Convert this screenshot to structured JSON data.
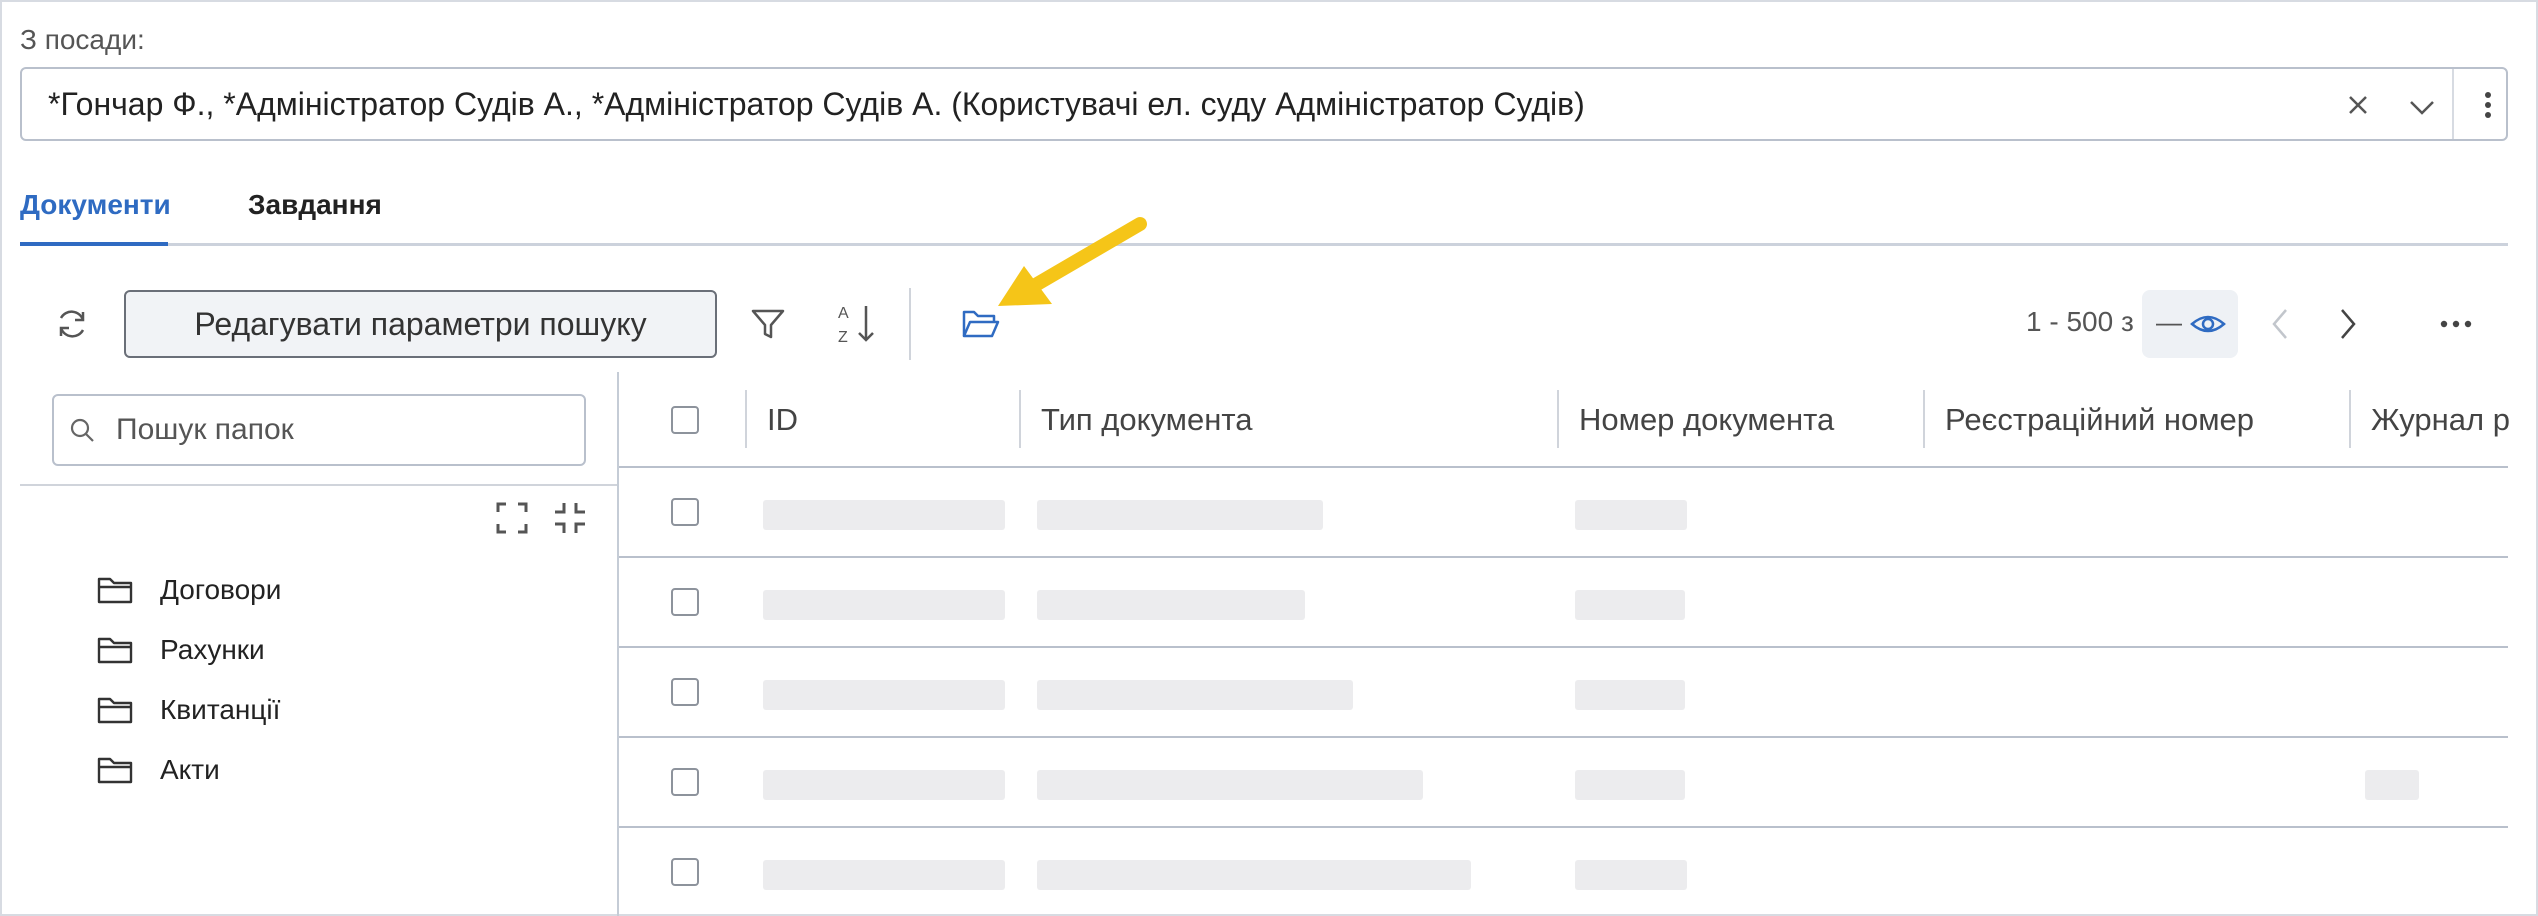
{
  "position": {
    "label": "З посади:",
    "value": "*Гончар Ф., *Адміністратор Судів А., *Адміністратор Судів А. (Користувачі ел. суду Адміністратор Судів)"
  },
  "tabs": [
    {
      "label": "Документи",
      "active": true
    },
    {
      "label": "Завдання",
      "active": false
    }
  ],
  "toolbar": {
    "edit_search_label": "Редагувати параметри пошуку",
    "pager_range": "1 - 500 з",
    "pager_total": "—"
  },
  "folders": {
    "search_placeholder": "Пошук папок",
    "items": [
      "Договори",
      "Рахунки",
      "Квитанції",
      "Акти"
    ]
  },
  "grid": {
    "columns": [
      "ID",
      "Тип документа",
      "Номер документа",
      "Реєстраційний номер",
      "Журнал р"
    ]
  },
  "colors": {
    "accent": "#2f6bc2",
    "annotation_arrow": "#f5c518"
  },
  "icons": {
    "refresh": "refresh-icon",
    "filter": "filter-icon",
    "sort": "sort-az-icon",
    "folder_open": "folder-open-icon",
    "eye": "eye-icon"
  }
}
